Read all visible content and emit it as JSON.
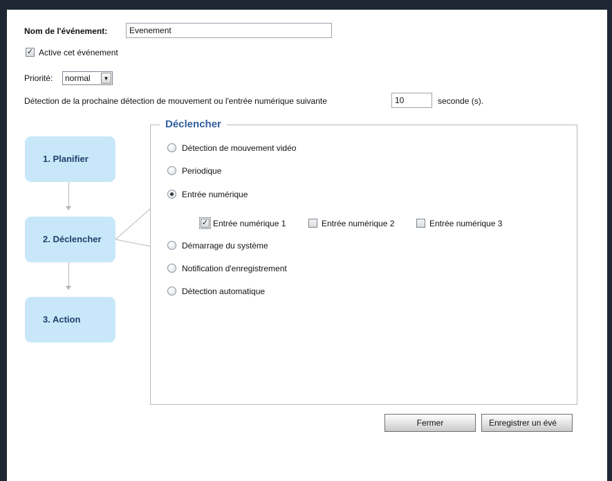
{
  "event_name": {
    "label": "Nom de l'événement:",
    "value": "Evenement"
  },
  "activate": {
    "label": "Active cet événement",
    "checked": true
  },
  "priority": {
    "label": "Priorité:",
    "selected": "normal"
  },
  "detection_delay": {
    "label_before": "Détection de la prochaine détection de mouvement ou l'entrée numérique suivante",
    "value": "10",
    "label_after": "seconde (s)."
  },
  "steps": [
    {
      "label": "1. Planifier"
    },
    {
      "label": "2. Déclencher"
    },
    {
      "label": "3. Action"
    }
  ],
  "trigger": {
    "legend": "Déclencher",
    "options": [
      {
        "label": "Détection de mouvement vidéo",
        "checked": false
      },
      {
        "label": "Periodique",
        "checked": false
      },
      {
        "label": "Entrée numérique",
        "checked": true
      },
      {
        "label": "Démarrage du système",
        "checked": false
      },
      {
        "label": "Notification d'enregistrement",
        "checked": false
      },
      {
        "label": "Détection automatique",
        "checked": false
      }
    ],
    "digital_inputs": [
      {
        "label": "Entrée numérique 1",
        "checked": true
      },
      {
        "label": "Entrée numérique 2",
        "checked": false
      },
      {
        "label": "Entrée numérique 3",
        "checked": false
      }
    ]
  },
  "buttons": {
    "close": "Fermer",
    "save": "Enregistrer un évé"
  },
  "colors": {
    "frame": "#1e2733",
    "step_bg": "#c8e8f9",
    "step_text": "#1f3e6b",
    "legend_text": "#2f5e9e"
  }
}
